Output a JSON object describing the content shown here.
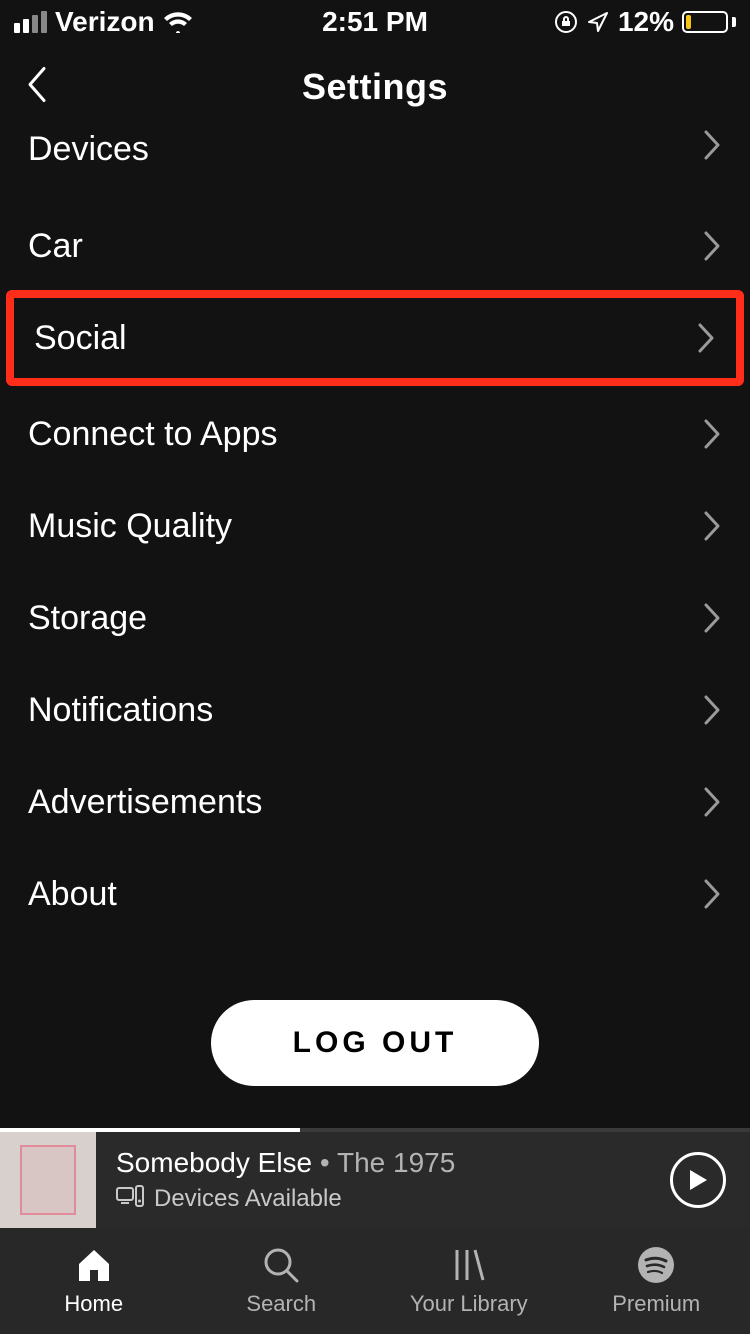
{
  "status": {
    "carrier": "Verizon",
    "time": "2:51 PM",
    "battery_pct": "12%"
  },
  "header": {
    "title": "Settings"
  },
  "rows": [
    {
      "label": "Devices"
    },
    {
      "label": "Car"
    },
    {
      "label": "Social",
      "highlighted": true
    },
    {
      "label": "Connect to Apps"
    },
    {
      "label": "Music Quality"
    },
    {
      "label": "Storage"
    },
    {
      "label": "Notifications"
    },
    {
      "label": "Advertisements"
    },
    {
      "label": "About"
    }
  ],
  "logout": {
    "label": "LOG OUT"
  },
  "nowplaying": {
    "title": "Somebody Else",
    "separator": " • ",
    "artist": "The 1975",
    "devices": "Devices Available"
  },
  "tabs": [
    {
      "label": "Home"
    },
    {
      "label": "Search"
    },
    {
      "label": "Your Library"
    },
    {
      "label": "Premium"
    }
  ]
}
